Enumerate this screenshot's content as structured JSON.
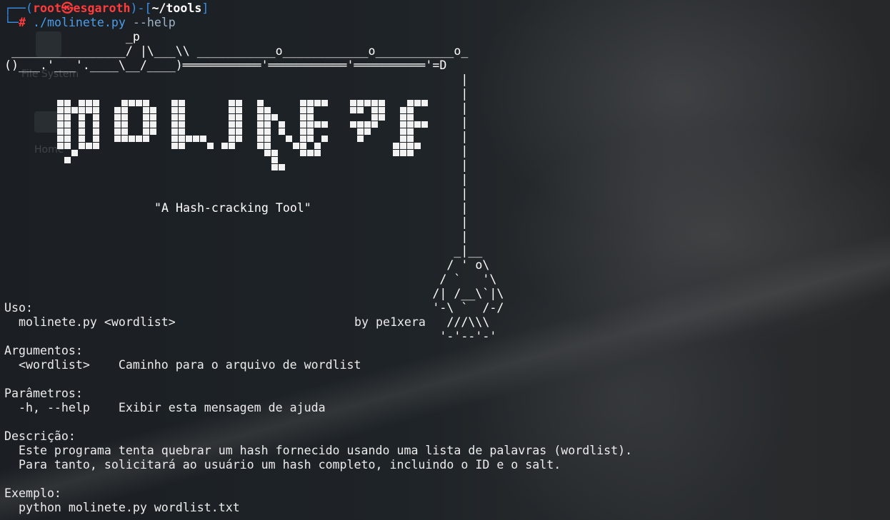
{
  "prompt": {
    "box_open": "┌──(",
    "user": "root㉿esgaroth",
    "box_mid": ")-[",
    "path": "~/tools",
    "box_close": "]",
    "line2_box": "└─",
    "symbol": "#",
    "executable": "./molinete.py",
    "argument": "--help"
  },
  "banner": {
    "ascii_lines": [
      "                 _p",
      " ________________/ |\\___\\\\ ___________o____________o___________o_",
      "()___.'___'.____\\__/____)═══════════'═══════════'══════════'=D",
      "                                                                |",
      "                                                                |",
      "                                                                |",
      "                                                                |",
      "                                                                |",
      "                                                                |",
      "                                                                |",
      "                                                                |",
      "                                                                |",
      "                                                                |",
      "                                                                |",
      "                                                                |",
      "                                                               _|__",
      "                                                              / ' o\\",
      "                                                             / `   '\\",
      "                                                            /| /__\\`|\\",
      "                                                            '-\\ `  /-/",
      "                                                              ///\\\\\\",
      "                                                             '-'--'-'"
    ],
    "logo_text": "MOLINETE",
    "tagline": "\"A Hash-cracking Tool\"",
    "author": "by pe1xera"
  },
  "help": {
    "usage_heading": "Uso:",
    "usage_line": "  molinete.py <wordlist>",
    "args_heading": "Argumentos:",
    "args_line": "  <wordlist>    Caminho para o arquivo de wordlist",
    "params_heading": "Parâmetros:",
    "params_line": "  -h, --help    Exibir esta mensagem de ajuda",
    "desc_heading": "Descrição:",
    "desc_line1": "  Este programa tenta quebrar um hash fornecido usando uma lista de palavras (wordlist).",
    "desc_line2": "  Para tanto, solicitará ao usuário um hash completo, incluindo o ID e o salt.",
    "example_heading": "Exemplo:",
    "example_line": "  python molinete.py wordlist.txt"
  },
  "desktop": {
    "filesystem_label": "File System",
    "home_label": "Home"
  },
  "colors": {
    "prompt_box": "#3a8ee6",
    "prompt_user": "#ff3b3b",
    "command": "#4a9dea"
  }
}
